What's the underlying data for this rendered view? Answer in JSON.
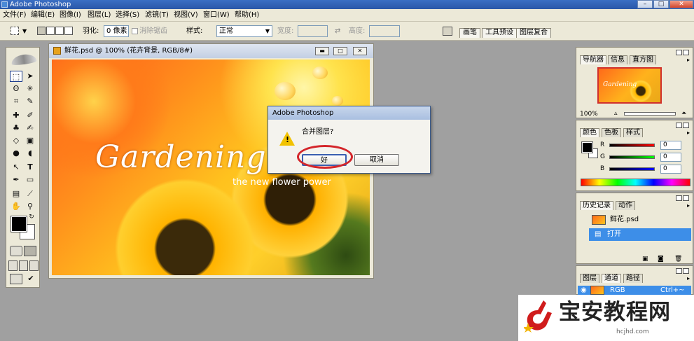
{
  "app": {
    "title": "Adobe Photoshop"
  },
  "menubar": [
    "文件(F)",
    "编辑(E)",
    "图像(I)",
    "图层(L)",
    "选择(S)",
    "滤镜(T)",
    "视图(V)",
    "窗口(W)",
    "帮助(H)"
  ],
  "options": {
    "feather_label": "羽化:",
    "feather_value": "0 像素",
    "antialias_label": "消除锯齿",
    "style_label": "样式:",
    "style_value": "正常",
    "width_label": "宽度:",
    "height_label": "高度:",
    "palette_tabs": [
      "画笔",
      "工具预设",
      "图层复合"
    ]
  },
  "document": {
    "title": "鲜花.psd @ 100% (花卉背景, RGB/8#)",
    "image_text_main": "Gardening C",
    "image_text_sub": "the new flower power"
  },
  "dialog": {
    "title": "Adobe Photoshop",
    "message": "合并图层?",
    "ok": "好",
    "cancel": "取消"
  },
  "navigator": {
    "tabs": [
      "导航器",
      "信息",
      "直方图"
    ],
    "zoom": "100%",
    "thumb_text": "Gardening"
  },
  "color": {
    "tabs": [
      "颜色",
      "色板",
      "样式"
    ],
    "r_label": "R",
    "g_label": "G",
    "b_label": "B",
    "r": "0",
    "g": "0",
    "b": "0"
  },
  "history": {
    "tabs": [
      "历史记录",
      "动作"
    ],
    "snapshot": "鲜花.psd",
    "step": "打开"
  },
  "layers": {
    "tabs": [
      "图层",
      "通道",
      "路径"
    ],
    "channel": "RGB",
    "shortcut": "Ctrl+~"
  },
  "watermark": {
    "name": "宝安教程网",
    "url": "hcjhd.com"
  },
  "colors": {
    "accent": "#3d8ee8",
    "highlight_ring": "#d4262b",
    "title_blue": "#2a57a8"
  }
}
